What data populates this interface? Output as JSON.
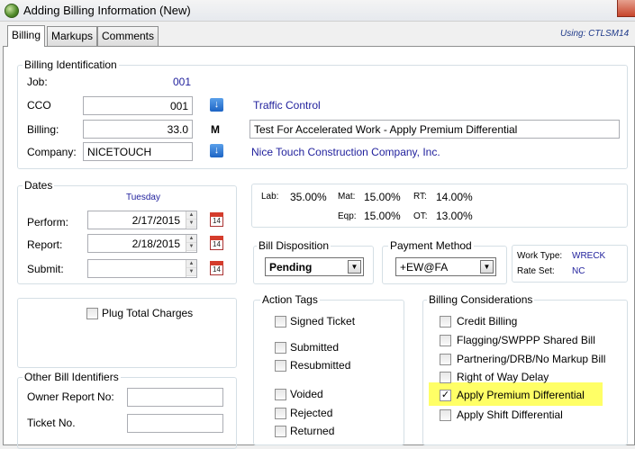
{
  "window": {
    "title": "Adding Billing Information  (New)"
  },
  "tabs": [
    {
      "label": "Billing"
    },
    {
      "label": "Markups"
    },
    {
      "label": "Comments"
    }
  ],
  "using": "Using:  CTLSM14",
  "billing_id": {
    "legend": "Billing Identification",
    "job_label": "Job:",
    "job_value": "001",
    "cco_label": "CCO",
    "cco_value": "001",
    "cco_desc": "Traffic Control",
    "billing_label": "Billing:",
    "billing_value": "33.0",
    "billing_flag": "M",
    "billing_desc": "Test For Accelerated Work - Apply Premium Differential",
    "company_label": "Company:",
    "company_value": "NICETOUCH",
    "company_desc": "Nice Touch Construction Company, Inc."
  },
  "dates": {
    "legend": "Dates",
    "day": "Tuesday",
    "perform_label": "Perform:",
    "perform_value": "2/17/2015",
    "report_label": "Report:",
    "report_value": "2/18/2015",
    "submit_label": "Submit:",
    "submit_value": "",
    "cal_text": "14"
  },
  "rates": {
    "lab_label": "Lab:",
    "lab_value": "35.00%",
    "mat_label": "Mat:",
    "mat_value": "15.00%",
    "rt_label": "RT:",
    "rt_value": "14.00%",
    "eqp_label": "Eqp:",
    "eqp_value": "15.00%",
    "ot_label": "OT:",
    "ot_value": "13.00%"
  },
  "bill_disposition": {
    "legend": "Bill Disposition",
    "value": "Pending"
  },
  "payment_method": {
    "legend": "Payment Method",
    "value": "+EW@FA"
  },
  "work_info": {
    "work_type_label": "Work Type:",
    "work_type_value": "WRECK",
    "rate_set_label": "Rate Set:",
    "rate_set_value": "NC"
  },
  "plug": {
    "label": "Plug Total Charges",
    "checked": false
  },
  "other_ids": {
    "legend": "Other Bill Identifiers",
    "owner_report_label": "Owner Report No:",
    "ticket_label": "Ticket No."
  },
  "action_tags": {
    "legend": "Action Tags",
    "items": [
      {
        "label": "Signed Ticket"
      },
      {
        "label": "Submitted"
      },
      {
        "label": "Resubmitted"
      },
      {
        "label": "Voided"
      },
      {
        "label": "Rejected"
      },
      {
        "label": "Returned"
      }
    ]
  },
  "billing_considerations": {
    "legend": "Billing Considerations",
    "items": [
      {
        "label": "Credit Billing",
        "checked": false
      },
      {
        "label": "Flagging/SWPPP Shared Bill",
        "checked": false
      },
      {
        "label": "Partnering/DRB/No Markup Bill",
        "checked": false
      },
      {
        "label": "Right of Way Delay",
        "checked": false
      },
      {
        "label": "Apply Premium Differential",
        "checked": true
      },
      {
        "label": "Apply Shift Differential",
        "checked": false
      }
    ]
  },
  "colors": {
    "highlight": "#ffff66",
    "link_blue": "#1f1f9c"
  }
}
